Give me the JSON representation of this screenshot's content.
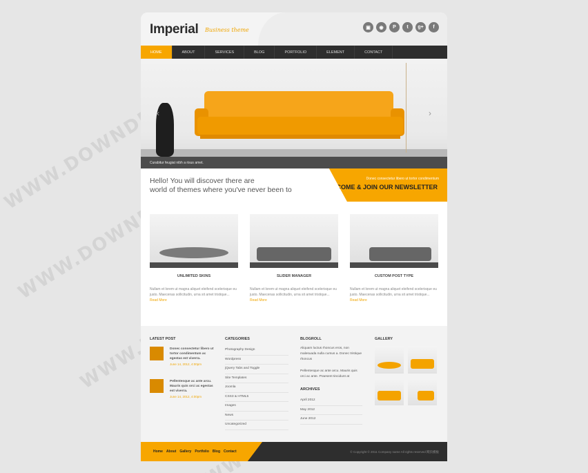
{
  "header": {
    "logo": "Imperial",
    "tagline": "Business theme",
    "social": [
      "▣",
      "◉",
      "P",
      "t",
      "g+",
      "f"
    ]
  },
  "nav": {
    "items": [
      "HOME",
      "ABOUT",
      "SERVICES",
      "BLOG",
      "PORTFOLIO",
      "ELEMENT",
      "CONTACT"
    ],
    "active": "HOME"
  },
  "slider": {
    "caption": "Curabitur feugiat nibh a risus amet.",
    "prev": "‹",
    "next": "›"
  },
  "welcome": {
    "line1": "Hello! You will discover there are",
    "line2": "world of themes where you've never been to"
  },
  "newsletter": {
    "subtitle": "Donec consectetur libero ut tortor condimentum",
    "title": "COME & JOIN OUR NEWSLETTER"
  },
  "features": [
    {
      "title": "UNLIMITED SKINS",
      "text": "Nullam et lorem ut magna aliquet eleifend scelerisque eu justo. Maecenas sollicitudin, urna sit amet tristique...",
      "more": "Read More"
    },
    {
      "title": "SLIDER MANAGER",
      "text": "Nullam et lorem ut magna aliquet eleifend scelerisque eu justo. Maecenas sollicitudin, urna sit amet tristique...",
      "more": "Read More"
    },
    {
      "title": "CUSTOM POST TYPE",
      "text": "Nullam et lorem ut magna aliquet eleifend scelerisque eu justo. Maecenas sollicitudin, urna sit amet tristique...",
      "more": "Read More"
    }
  ],
  "latest_post": {
    "title": "LATEST POST",
    "posts": [
      {
        "text": "Donec consectetur libero ut tortor condimentum ac egestas est viverra.",
        "date": "June 14, 2012, 4:00pm"
      },
      {
        "text": "Pellentesque ac ante arcu. Mauris quis orci ac egestas est viverra.",
        "date": "June 14, 2012, 4:00pm"
      }
    ]
  },
  "categories": {
    "title": "CATEGORIES",
    "items": [
      "Photography Design",
      "Wordpress",
      "jQuery Tabs and Toggle",
      "Site Templates",
      "Joomla",
      "CSS3 & HTML5",
      "Images",
      "News",
      "Uncategorized"
    ]
  },
  "blogroll": {
    "title": "BLOGROLL",
    "items": [
      "Aliquam luctus rhoncus eros, non malesuada nulla cursus a. Donec tristique rhoncus",
      "Pellentesque ac ante arcu. Mauris quis orci ac ante. Praesent tincidunt at"
    ]
  },
  "archives": {
    "title": "ARCHIVES",
    "items": [
      "April 2012",
      "May 2012",
      "June 2012"
    ]
  },
  "gallery": {
    "title": "GALLERY"
  },
  "footer": {
    "links": [
      "Home",
      "About",
      "Gallery",
      "Portfolio",
      "Blog",
      "Contact"
    ],
    "copyright": "© Copyright © 2011 Company name All rights reserved 网页模板"
  },
  "watermark": "WWW.DOWNDEMO.COM"
}
